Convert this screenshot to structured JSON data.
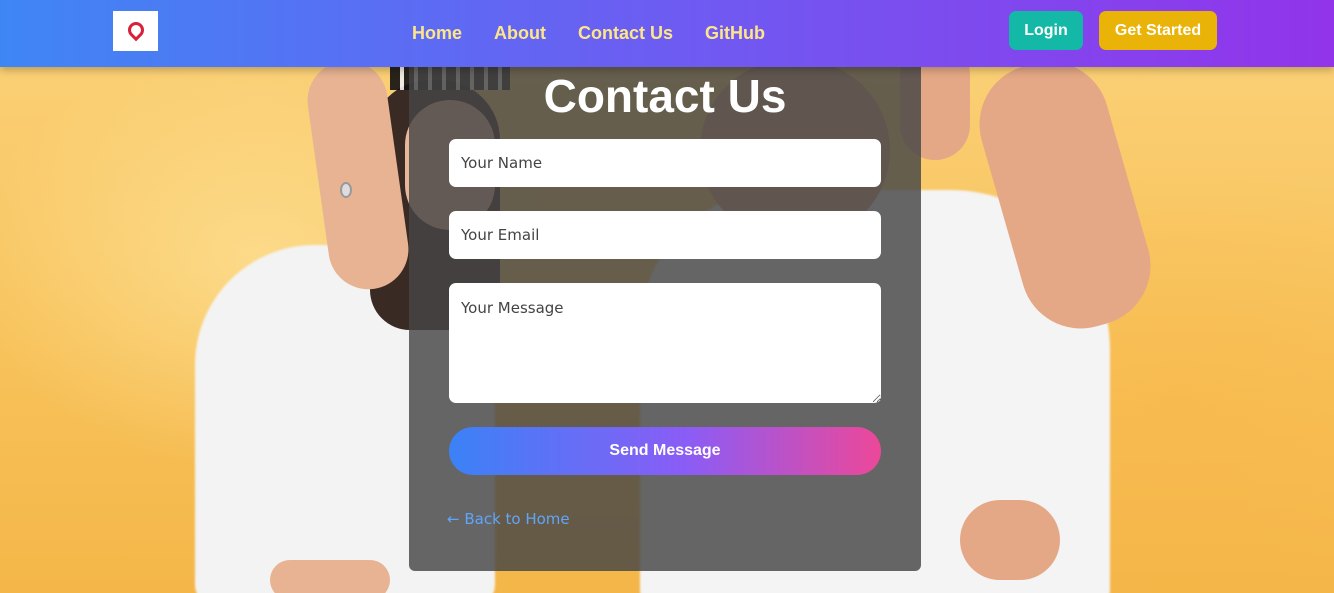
{
  "nav": {
    "logo_alt": "logo",
    "links": [
      "Home",
      "About",
      "Contact Us",
      "GitHub"
    ],
    "login_label": "Login",
    "get_started_label": "Get Started"
  },
  "contact": {
    "title": "Contact Us",
    "name_placeholder": "Your Name",
    "email_placeholder": "Your Email",
    "message_placeholder": "Your Message",
    "send_label": "Send Message",
    "back_link": "← Back to Home"
  },
  "colors": {
    "nav_gradient_start": "#3f86f5",
    "nav_gradient_end": "#9234ea",
    "nav_link": "#fde68a",
    "login_bg": "#14b8a6",
    "get_started_bg": "#eab308",
    "send_gradient": [
      "#3b82f6",
      "#8b5cf6",
      "#ec4899"
    ],
    "back_link": "#60a5fa"
  }
}
